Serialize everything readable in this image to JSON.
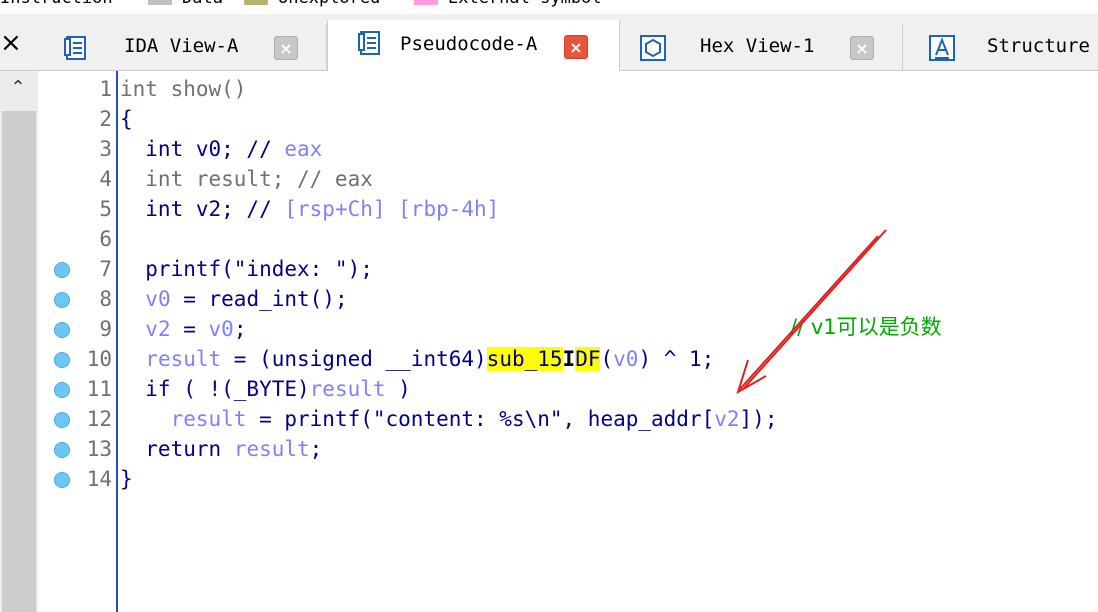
{
  "legend": {
    "items": [
      {
        "label": "Instruction",
        "color": "#ffffff"
      },
      {
        "label": "Data",
        "color": "#c0c0c0"
      },
      {
        "label": "Unexplored",
        "color": "#b5b56e"
      },
      {
        "label": "External symbol",
        "color": "#ff9ae8"
      }
    ]
  },
  "tabs": [
    {
      "label": "IDA View-A",
      "icon": "ida-view-icon",
      "close": "×",
      "active": false
    },
    {
      "label": "Pseudocode-A",
      "icon": "pseudocode-icon",
      "close": "×",
      "active": true
    },
    {
      "label": "Hex View-1",
      "icon": "hex-view-icon",
      "close": "×",
      "active": false
    },
    {
      "label": "Structure",
      "icon": "structure-icon",
      "active": false
    }
  ],
  "close_all": "×",
  "scroll_up": "⌃",
  "code_lines": [
    {
      "n": "1",
      "bp": false,
      "parts": [
        {
          "t": "int show()",
          "c": "dim"
        }
      ]
    },
    {
      "n": "2",
      "bp": false,
      "parts": [
        {
          "t": "{",
          "c": "blue"
        }
      ]
    },
    {
      "n": "3",
      "bp": false,
      "parts": [
        {
          "t": "  int v0; // ",
          "c": "blue"
        },
        {
          "t": "eax",
          "c": "lblue"
        }
      ]
    },
    {
      "n": "4",
      "bp": false,
      "parts": [
        {
          "t": "  int result; // eax",
          "c": "dim"
        }
      ]
    },
    {
      "n": "5",
      "bp": false,
      "parts": [
        {
          "t": "  int v2; // ",
          "c": "blue"
        },
        {
          "t": "[rsp+Ch] [rbp-4h]",
          "c": "lblue"
        }
      ]
    },
    {
      "n": "6",
      "bp": false,
      "parts": [
        {
          "t": "",
          "c": "blue"
        }
      ]
    },
    {
      "n": "7",
      "bp": true,
      "parts": [
        {
          "t": "  printf(\"index: \");",
          "c": "blue"
        }
      ]
    },
    {
      "n": "8",
      "bp": true,
      "parts": [
        {
          "t": "  ",
          "c": "blue"
        },
        {
          "t": "v0",
          "c": "lblue"
        },
        {
          "t": " = read_int();",
          "c": "blue"
        }
      ]
    },
    {
      "n": "9",
      "bp": true,
      "parts": [
        {
          "t": "  ",
          "c": "blue"
        },
        {
          "t": "v2",
          "c": "lblue"
        },
        {
          "t": " = ",
          "c": "blue"
        },
        {
          "t": "v0",
          "c": "lblue"
        },
        {
          "t": ";",
          "c": "blue"
        }
      ]
    },
    {
      "n": "10",
      "bp": true,
      "parts": [
        {
          "t": "  ",
          "c": "blue"
        },
        {
          "t": "result",
          "c": "lblue"
        },
        {
          "t": " = (unsigned __int64)",
          "c": "blue"
        },
        {
          "t": "sub_15",
          "c": "hl"
        },
        {
          "t": "I",
          "c": "cursor"
        },
        {
          "t": "DF",
          "c": "hl"
        },
        {
          "t": "(",
          "c": "blue"
        },
        {
          "t": "v0",
          "c": "lblue"
        },
        {
          "t": ") ^ 1;",
          "c": "blue"
        }
      ]
    },
    {
      "n": "11",
      "bp": true,
      "parts": [
        {
          "t": "  if ( !(_BYTE)",
          "c": "blue"
        },
        {
          "t": "result",
          "c": "lblue"
        },
        {
          "t": " )",
          "c": "blue"
        }
      ]
    },
    {
      "n": "12",
      "bp": true,
      "parts": [
        {
          "t": "    ",
          "c": "blue"
        },
        {
          "t": "result",
          "c": "lblue"
        },
        {
          "t": " = printf(\"content: %s\\n\", heap_addr[",
          "c": "blue"
        },
        {
          "t": "v2",
          "c": "lblue"
        },
        {
          "t": "]);",
          "c": "blue"
        }
      ]
    },
    {
      "n": "13",
      "bp": true,
      "parts": [
        {
          "t": "  return ",
          "c": "blue"
        },
        {
          "t": "result",
          "c": "lblue"
        },
        {
          "t": ";",
          "c": "blue"
        }
      ]
    },
    {
      "n": "14",
      "bp": true,
      "parts": [
        {
          "t": "}",
          "c": "blue"
        }
      ]
    }
  ],
  "annotation": {
    "text": "// v1可以是负数",
    "color": "#00aa00"
  },
  "arrow_color": "#e02020"
}
